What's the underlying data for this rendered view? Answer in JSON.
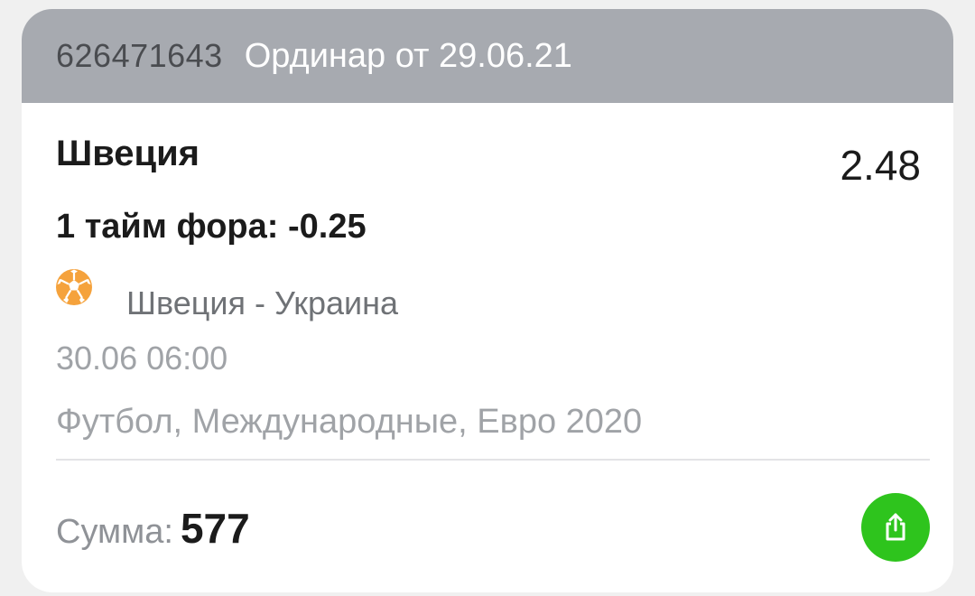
{
  "header": {
    "bet_id": "626471643",
    "title": "Ординар от 29.06.21"
  },
  "bet": {
    "selection": "Швеция",
    "odds": "2.48",
    "market": "1 тайм фора: -0.25",
    "sport_icon": "soccer-ball-icon",
    "match": "Швеция - Украина",
    "datetime": "30.06 06:00",
    "league": "Футбол, Международные, Евро 2020"
  },
  "footer": {
    "sum_label": "Сумма:",
    "sum_value": "577",
    "share_icon": "share-icon"
  },
  "colors": {
    "header_bg": "#a7aab0",
    "accent_green": "#2ec41d",
    "ball_orange": "#f5a23c"
  }
}
